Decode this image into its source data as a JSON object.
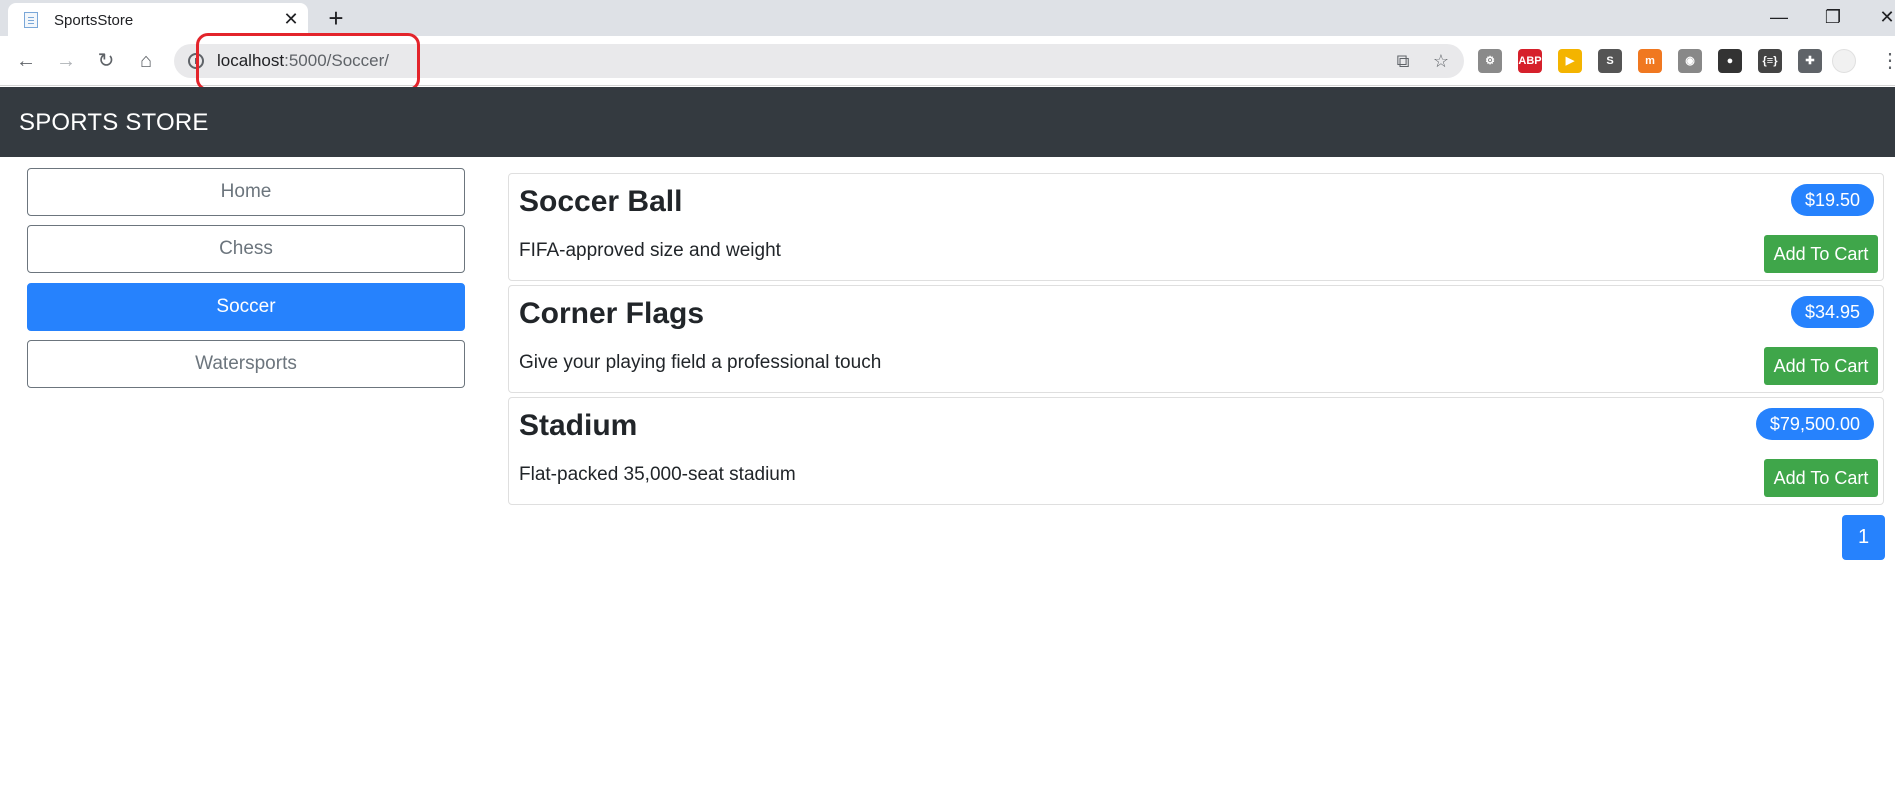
{
  "browser": {
    "tab_title": "SportsStore",
    "tab_close": "✕",
    "new_tab": "+",
    "url_host": "localhost",
    "url_path": ":5000/Soccer/",
    "window_controls": [
      "—",
      "❐",
      "✕"
    ],
    "nav_icons": [
      "back-arrow-icon",
      "forward-arrow-icon",
      "reload-icon",
      "home-icon"
    ],
    "extensions": [
      {
        "name": "settings-gear-extension-icon",
        "label": "⚙",
        "color": "#8a8a8a"
      },
      {
        "name": "adblock-plus-extension-icon",
        "label": "ABP",
        "color": "#d6202b"
      },
      {
        "name": "play-extension-icon",
        "label": "▶",
        "color": "#f4b400"
      },
      {
        "name": "s-extension-icon",
        "label": "S",
        "color": "#555555"
      },
      {
        "name": "m-extension-icon",
        "label": "m",
        "color": "#f07820"
      },
      {
        "name": "wifi-extension-icon",
        "label": "◉",
        "color": "#888888"
      },
      {
        "name": "balls-extension-icon",
        "label": "●",
        "color": "#333333"
      },
      {
        "name": "json-extension-icon",
        "label": "{≡}",
        "color": "#444444"
      },
      {
        "name": "puzzle-extension-icon",
        "label": "✚",
        "color": "#5f6368"
      }
    ]
  },
  "navbar": {
    "brand": "SPORTS STORE"
  },
  "categories": [
    {
      "label": "Home",
      "active": false
    },
    {
      "label": "Chess",
      "active": false
    },
    {
      "label": "Soccer",
      "active": true
    },
    {
      "label": "Watersports",
      "active": false
    }
  ],
  "products": [
    {
      "name": "Soccer Ball",
      "description": "FIFA-approved size and weight",
      "price": "$19.50",
      "button": "Add To Cart"
    },
    {
      "name": "Corner Flags",
      "description": "Give your playing field a professional touch",
      "price": "$34.95",
      "button": "Add To Cart"
    },
    {
      "name": "Stadium",
      "description": "Flat-packed 35,000-seat stadium",
      "price": "$79,500.00",
      "button": "Add To Cart"
    }
  ],
  "pagination": {
    "current": "1"
  },
  "colors": {
    "navbar": "#343a40",
    "primary": "#2682fd",
    "success": "#3fa64a",
    "highlight": "#e3242b"
  }
}
